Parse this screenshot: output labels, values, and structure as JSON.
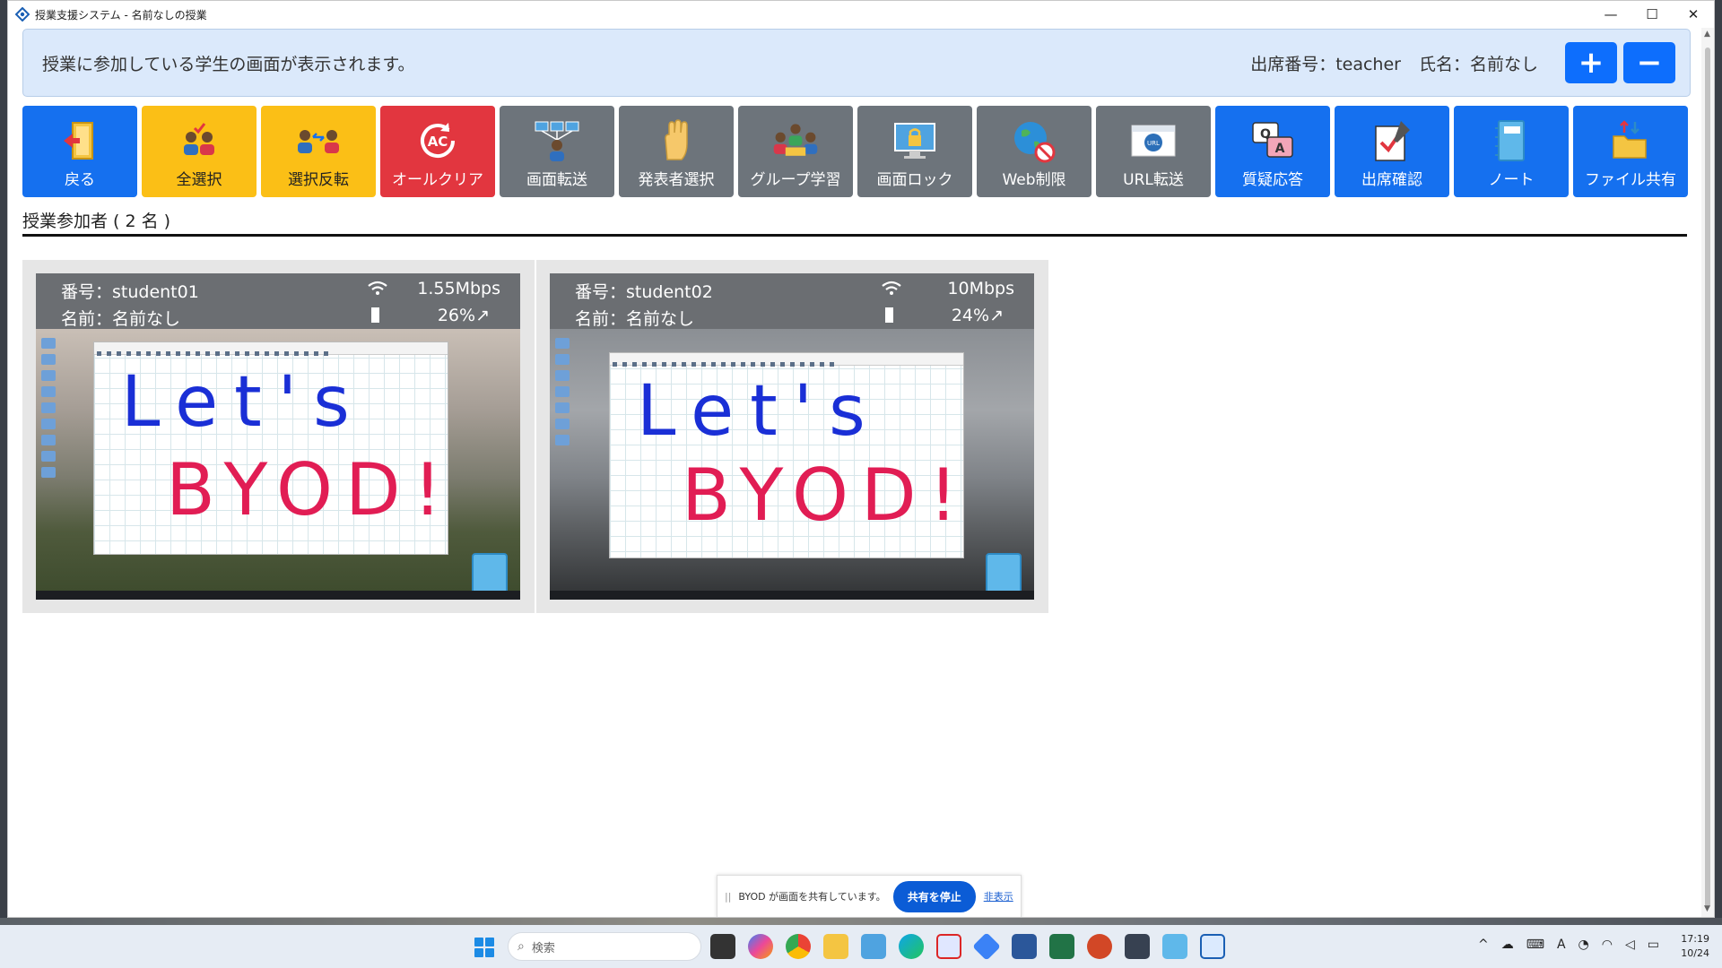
{
  "window": {
    "title": "授業支援システム - 名前なしの授業",
    "minimize": "—",
    "maximize": "☐",
    "close": "✕"
  },
  "banner": {
    "message": "授業に参加している学生の画面が表示されます。",
    "seat": "出席番号：teacher",
    "name": "氏名：名前なし",
    "plus_label": "+",
    "minus_label": "−"
  },
  "toolbar": [
    {
      "label": "戻る",
      "icon": "door-exit-icon",
      "color": "#1570ef"
    },
    {
      "label": "全選択",
      "icon": "select-all-users-icon",
      "color": "#fbbf16"
    },
    {
      "label": "選択反転",
      "icon": "invert-selection-icon",
      "color": "#fbbf16"
    },
    {
      "label": "オールクリア",
      "icon": "all-clear-icon",
      "color": "#e2363f"
    },
    {
      "label": "画面転送",
      "icon": "screen-transfer-icon",
      "color": "#6d747b"
    },
    {
      "label": "発表者選択",
      "icon": "raised-hand-icon",
      "color": "#6d747b"
    },
    {
      "label": "グループ学習",
      "icon": "group-learning-icon",
      "color": "#6d747b"
    },
    {
      "label": "画面ロック",
      "icon": "screen-lock-icon",
      "color": "#6d747b"
    },
    {
      "label": "Web制限",
      "icon": "web-restrict-icon",
      "color": "#6d747b"
    },
    {
      "label": "URL転送",
      "icon": "url-transfer-icon",
      "color": "#6d747b"
    },
    {
      "label": "質疑応答",
      "icon": "qa-icon",
      "color": "#1570ef"
    },
    {
      "label": "出席確認",
      "icon": "attendance-check-icon",
      "color": "#1570ef"
    },
    {
      "label": "ノート",
      "icon": "notebook-icon",
      "color": "#1570ef"
    },
    {
      "label": "ファイル共有",
      "icon": "file-share-icon",
      "color": "#1570ef"
    }
  ],
  "participants": {
    "heading": "授業参加者 ( 2 名 )",
    "students": [
      {
        "id": "番号：student01",
        "name": "名前：名前なし",
        "speed": "1.55Mbps",
        "battery": "26%↗",
        "board_line1": "Let's",
        "board_line2": "BYOD!"
      },
      {
        "id": "番号：student02",
        "name": "名前：名前なし",
        "speed": "10Mbps",
        "battery": "24%↗",
        "board_line1": "Let's",
        "board_line2": "BYOD!"
      }
    ]
  },
  "sharebar": {
    "grip": "||",
    "message": "BYOD が画面を共有しています。",
    "stop_label": "共有を停止",
    "hide_label": "非表示"
  },
  "taskbar": {
    "search_placeholder": "検索",
    "time": "17:19",
    "date": "10/24",
    "tray_ime": "A"
  }
}
